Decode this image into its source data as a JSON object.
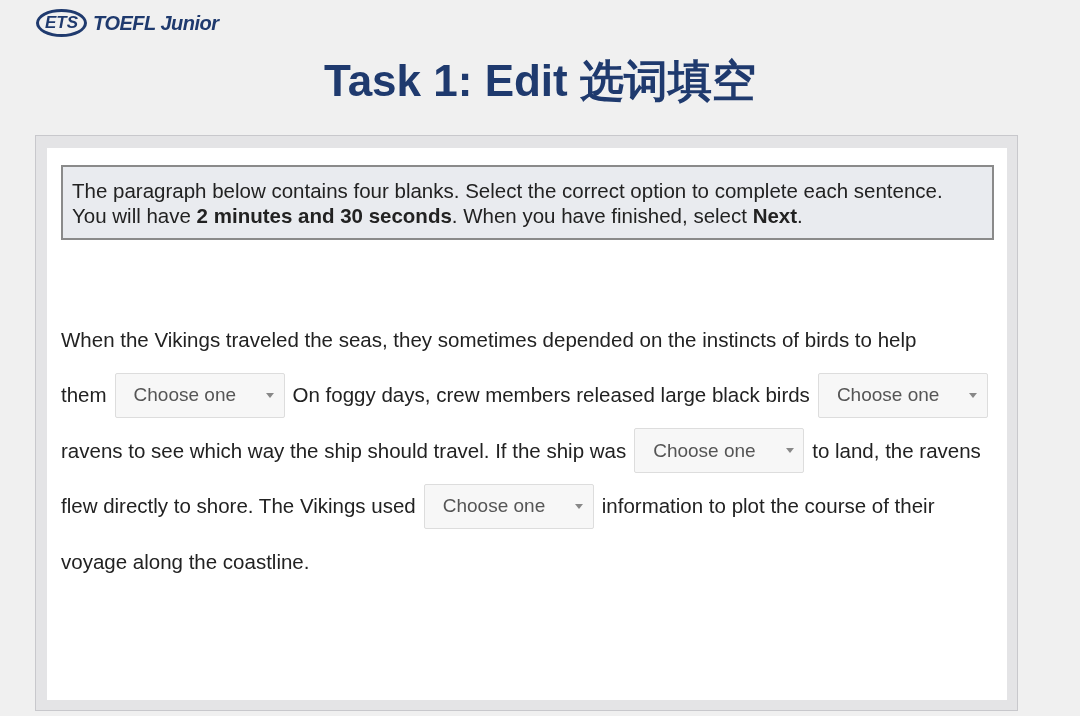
{
  "logo": {
    "mark": "ETS",
    "name": "TOEFL Junior"
  },
  "title": "Task 1: Edit 选词填空",
  "instructions": "The paragraph below contains four blanks. Select the correct option to complete each sentence. You will have **2 minutes and 30 seconds**. When you have finished, select **Next**.",
  "passage": {
    "lines": [
      [
        {
          "kind": "text",
          "text": "When the Vikings traveled the seas, they sometimes depended on the instincts of birds to help"
        }
      ],
      [
        {
          "kind": "text",
          "text": "them"
        },
        {
          "kind": "dropdown",
          "value": "Choose one"
        },
        {
          "kind": "text",
          "text": "On foggy days, crew members released large black birds"
        },
        {
          "kind": "dropdown",
          "value": "Choose one"
        }
      ],
      [
        {
          "kind": "text",
          "text": "ravens to see which way the ship should travel. If the ship was"
        },
        {
          "kind": "dropdown",
          "value": "Choose one"
        },
        {
          "kind": "text",
          "text": "to land, the ravens"
        }
      ],
      [
        {
          "kind": "text",
          "text": "flew directly to shore. The Vikings used"
        },
        {
          "kind": "dropdown",
          "value": "Choose one"
        },
        {
          "kind": "text",
          "text": "information to plot the course of their"
        }
      ],
      [
        {
          "kind": "text",
          "text": "voyage along the coastline."
        }
      ]
    ]
  }
}
